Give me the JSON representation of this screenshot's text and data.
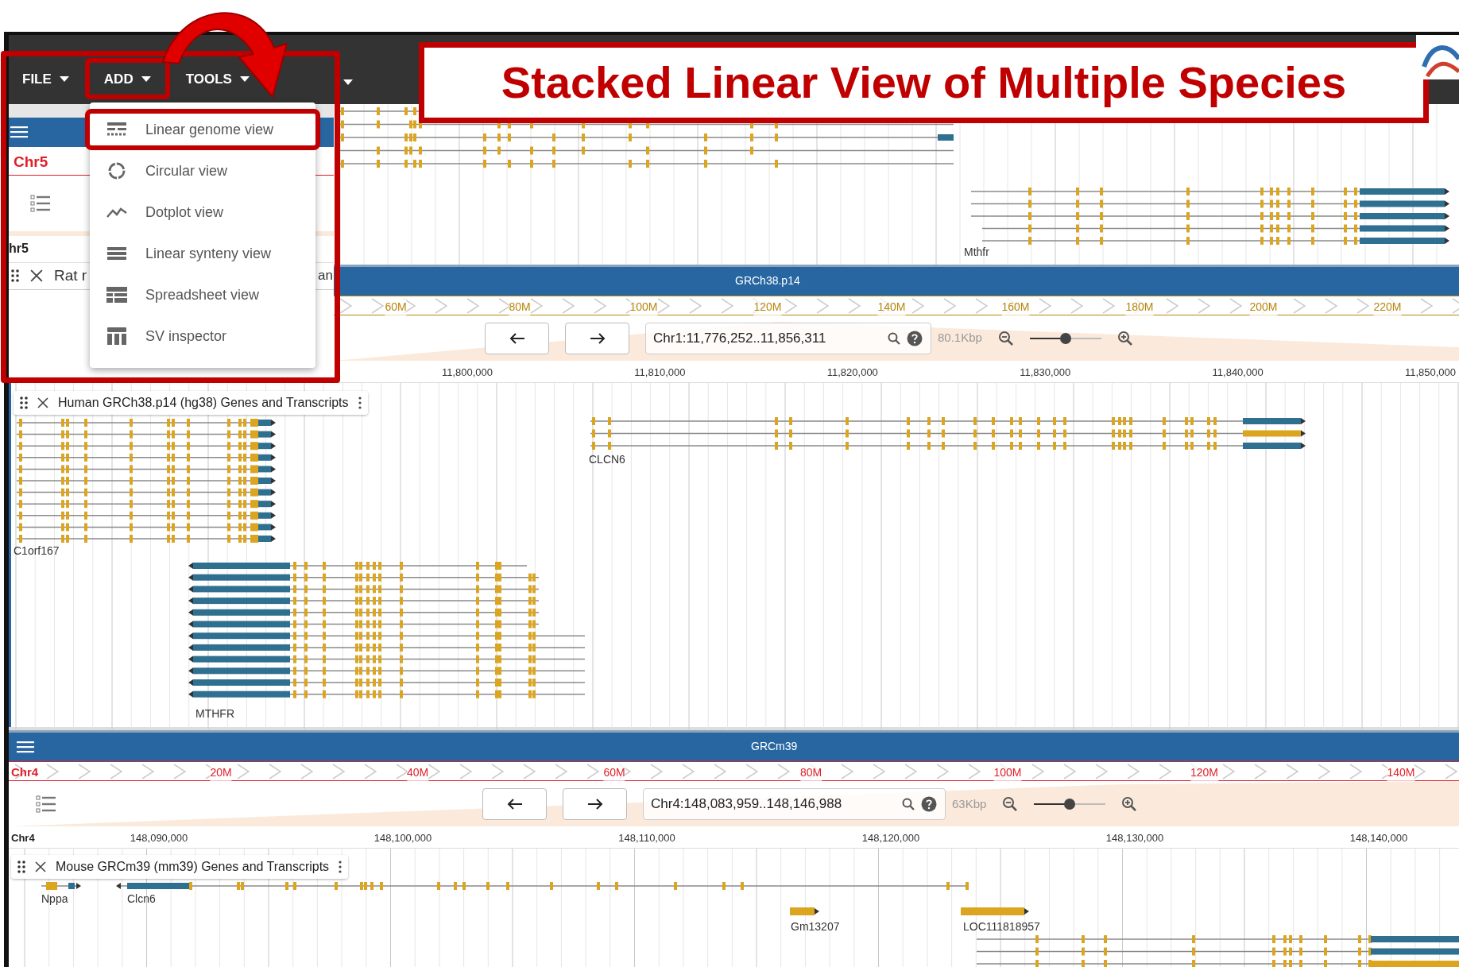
{
  "annotation": {
    "title": "Stacked Linear View of Multiple Species"
  },
  "menubar": [
    {
      "label": "FILE",
      "highlighted": false
    },
    {
      "label": "ADD",
      "highlighted": true
    },
    {
      "label": "TOOLS",
      "highlighted": false
    }
  ],
  "add_menu": [
    {
      "kind": "linear",
      "label": "Linear genome view",
      "highlighted": true
    },
    {
      "kind": "circular",
      "label": "Circular view",
      "highlighted": false
    },
    {
      "kind": "dotplot",
      "label": "Dotplot view",
      "highlighted": false
    },
    {
      "kind": "synteny",
      "label": "Linear synteny view",
      "highlighted": false
    },
    {
      "kind": "spreadsheet",
      "label": "Spreadsheet view",
      "highlighted": false
    },
    {
      "kind": "sv",
      "label": "SV inspector",
      "highlighted": false
    }
  ],
  "rat_view": {
    "ruler_label": "Chr5",
    "scale_label": "hr5",
    "track_label_parts": [
      "Rat r",
      "an"
    ],
    "gene_labels": [
      "Mthfr"
    ]
  },
  "views": [
    {
      "assembly": "GRCh38.p14",
      "color": "#b8860b",
      "ruler_ticks": [
        "60M",
        "80M",
        "100M",
        "120M",
        "140M",
        "160M",
        "180M",
        "200M",
        "220M"
      ],
      "location": "Chr1:11,776,252..11,856,311",
      "span": "80.1Kbp",
      "level": 0.5,
      "scale_ticks": [
        "11,800,000",
        "11,810,000",
        "11,820,000",
        "11,830,000",
        "11,840,000",
        "11,850,000"
      ],
      "track": "Human GRCh38.p14 (hg38) Genes and Transcripts",
      "gene_labels": [
        "C1orf167",
        "CLCN6",
        "MTHFR"
      ]
    },
    {
      "assembly": "GRCm39",
      "color": "#e0202a",
      "ruler_label": "Chr4",
      "ruler_ticks": [
        "20M",
        "40M",
        "60M",
        "80M",
        "100M",
        "120M",
        "140M"
      ],
      "location": "Chr4:148,083,959..148,146,988",
      "span": "63Kbp",
      "level": 0.5,
      "scale_label": "Chr4",
      "scale_ticks": [
        "148,090,000",
        "148,100,000",
        "148,110,000",
        "148,120,000",
        "148,130,000",
        "148,140,000"
      ],
      "track": "Mouse GRCm39 (mm39) Genes and Transcripts",
      "gene_labels": [
        "Nppa",
        "Clcn6",
        "Gm13207",
        "LOC111818957"
      ]
    }
  ]
}
